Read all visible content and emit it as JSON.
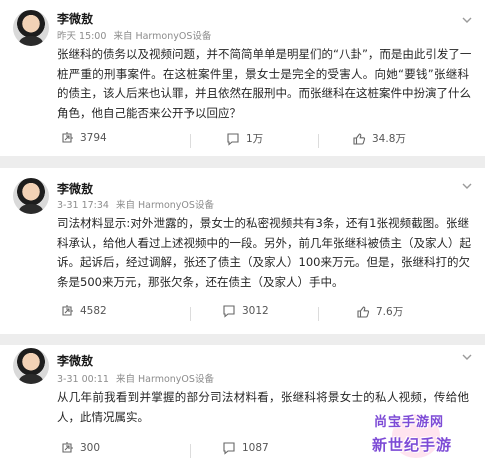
{
  "posts": [
    {
      "author": "李微敖",
      "time": "昨天 15:00",
      "source": "来自 HarmonyOS设备",
      "lines": [
        "张继科的债务以及视频问题，并不简简单单是明星们的“八卦”，而是由此引发了一",
        "桩严重的刑事案件。在这桩案件里，景女士是完全的受害人。向她“要钱”张继科",
        "的债主，该人后来也认罪，并且依然在服刑中。而张继科在这桩案件中扮演了什么",
        "角色，他自己能否来公开予以回应？"
      ],
      "reposts": "3794",
      "comments": "1万",
      "likes": "34.8万"
    },
    {
      "author": "李微敖",
      "time": "3-31 17:34",
      "source": "来自 HarmonyOS设备",
      "lines": [
        "司法材料显示:对外泄露的，景女士的私密视频共有3条，还有1张视频截图。张继",
        "科承认，给他人看过上述视频中的一段。另外，前几年张继科被债主（及家人）起",
        "诉。起诉后，经过调解，张还了债主（及家人）100来万元。但是，张继科打的欠",
        "条是500来万元，那张欠条，还在债主（及家人）手中。"
      ],
      "reposts": "4582",
      "comments": "3012",
      "likes": "7.6万"
    },
    {
      "author": "李微敖",
      "time": "3-31 00:11",
      "source": "来自 HarmonyOS设备",
      "lines": [
        "从几年前我看到并掌握的部分司法材料看，张继科将景女士的私人视频，传给他",
        "人，此情况属实。"
      ],
      "reposts": "300",
      "comments": "1087",
      "likes": ""
    }
  ],
  "watermark": {
    "line1": "尚宝手游网",
    "line2": "新世纪手游"
  },
  "colors": {
    "background": "#ededed",
    "card": "#ffffff",
    "meta_text": "#8c8c8c",
    "watermark": "#7d4bd6"
  }
}
